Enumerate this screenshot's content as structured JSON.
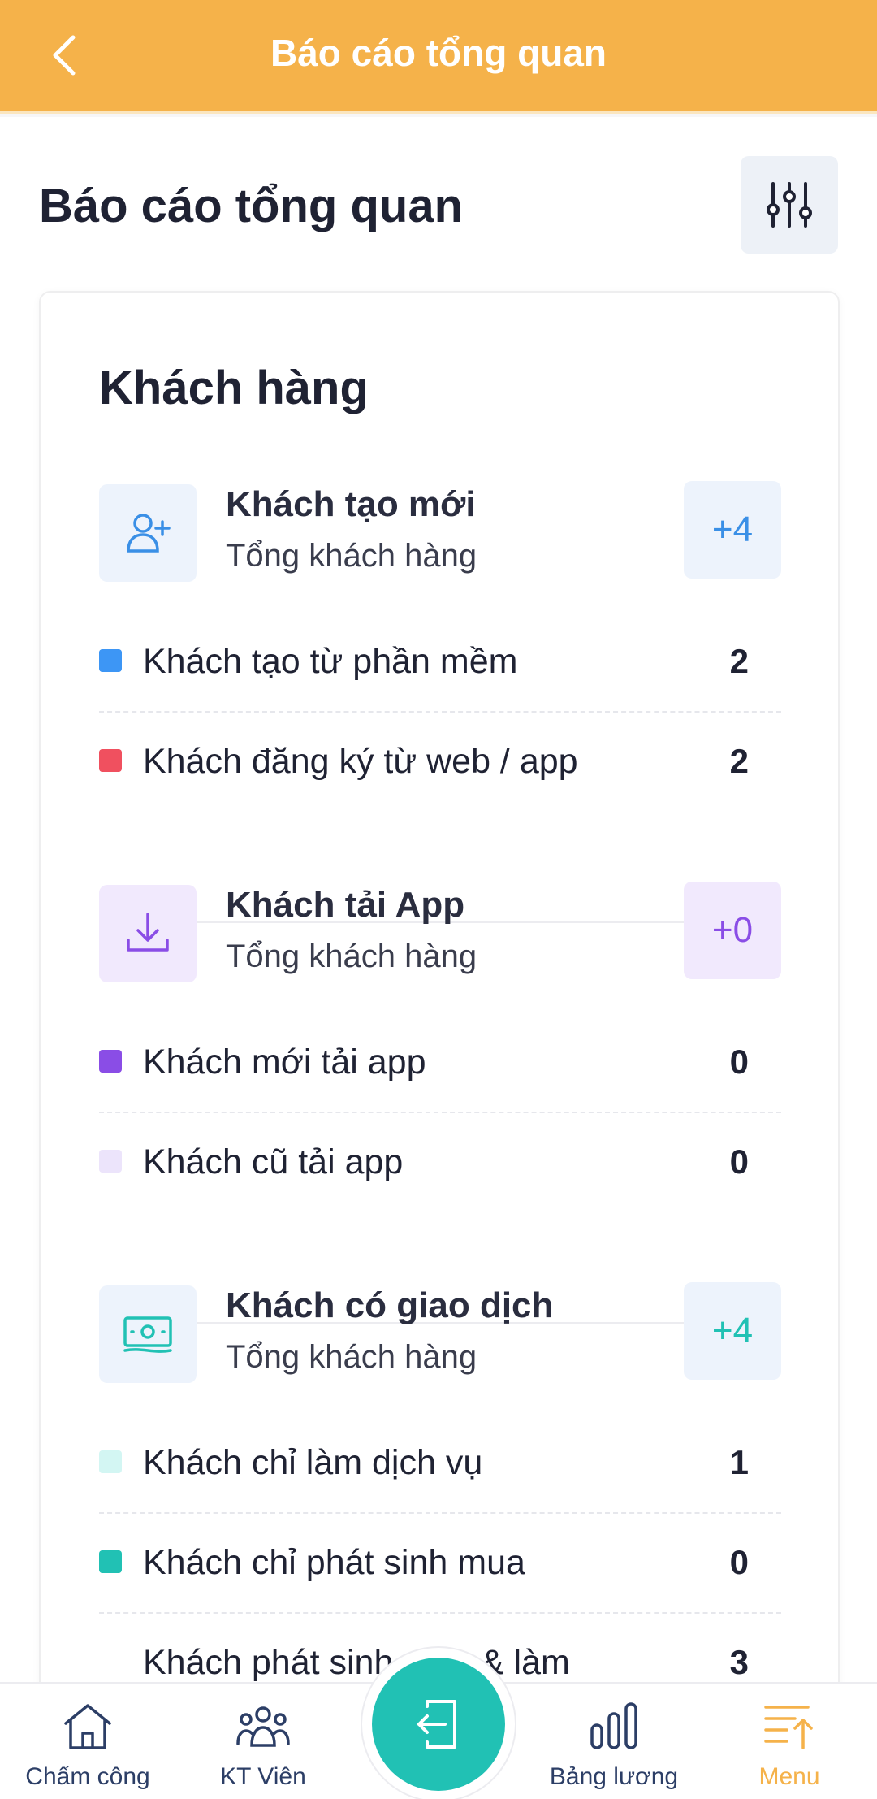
{
  "header": {
    "title": "Báo cáo tổng quan"
  },
  "page": {
    "title": "Báo cáo tổng quan"
  },
  "card": {
    "title": "Khách hàng",
    "groups": [
      {
        "title": "Khách tạo mới",
        "subtitle": "Tổng khách hàng",
        "badge": "+4",
        "icon": "user-plus-icon",
        "accent": "#3a8fe6",
        "rows": [
          {
            "label": "Khách tạo từ phần mềm",
            "value": "2",
            "color": "#3d96f5"
          },
          {
            "label": "Khách đăng ký từ web / app",
            "value": "2",
            "color": "#f0505f"
          }
        ]
      },
      {
        "title": "Khách tải App",
        "subtitle": "Tổng khách hàng",
        "badge": "+0",
        "icon": "download-icon",
        "accent": "#8a4de6",
        "rows": [
          {
            "label": "Khách mới tải app",
            "value": "0",
            "color": "#8a4de6"
          },
          {
            "label": "Khách cũ tải app",
            "value": "0",
            "color": "#ece4fb"
          }
        ]
      },
      {
        "title": "Khách có giao dịch",
        "subtitle": "Tổng khách hàng",
        "badge": "+4",
        "icon": "money-icon",
        "accent": "#21c1b4",
        "rows": [
          {
            "label": "Khách chỉ làm dịch vụ",
            "value": "1",
            "color": "#d3f6f3"
          },
          {
            "label": "Khách chỉ phát sinh mua",
            "value": "0",
            "color": "#21c1b4"
          },
          {
            "label": "Khách phát sinh mua & làm",
            "value": "3",
            "color": "#ffffff"
          }
        ]
      }
    ]
  },
  "tabbar": {
    "items": [
      {
        "label": "Chấm công",
        "icon": "home-icon"
      },
      {
        "label": "KT Viên",
        "icon": "users-icon"
      },
      {
        "label": "Bảng lương",
        "icon": "bar-chart-icon"
      },
      {
        "label": "Menu",
        "icon": "menu-icon",
        "active": true
      }
    ],
    "fab_icon": "login-icon"
  },
  "colors": {
    "brand": "#f5b24a",
    "teal": "#21c1b4"
  }
}
